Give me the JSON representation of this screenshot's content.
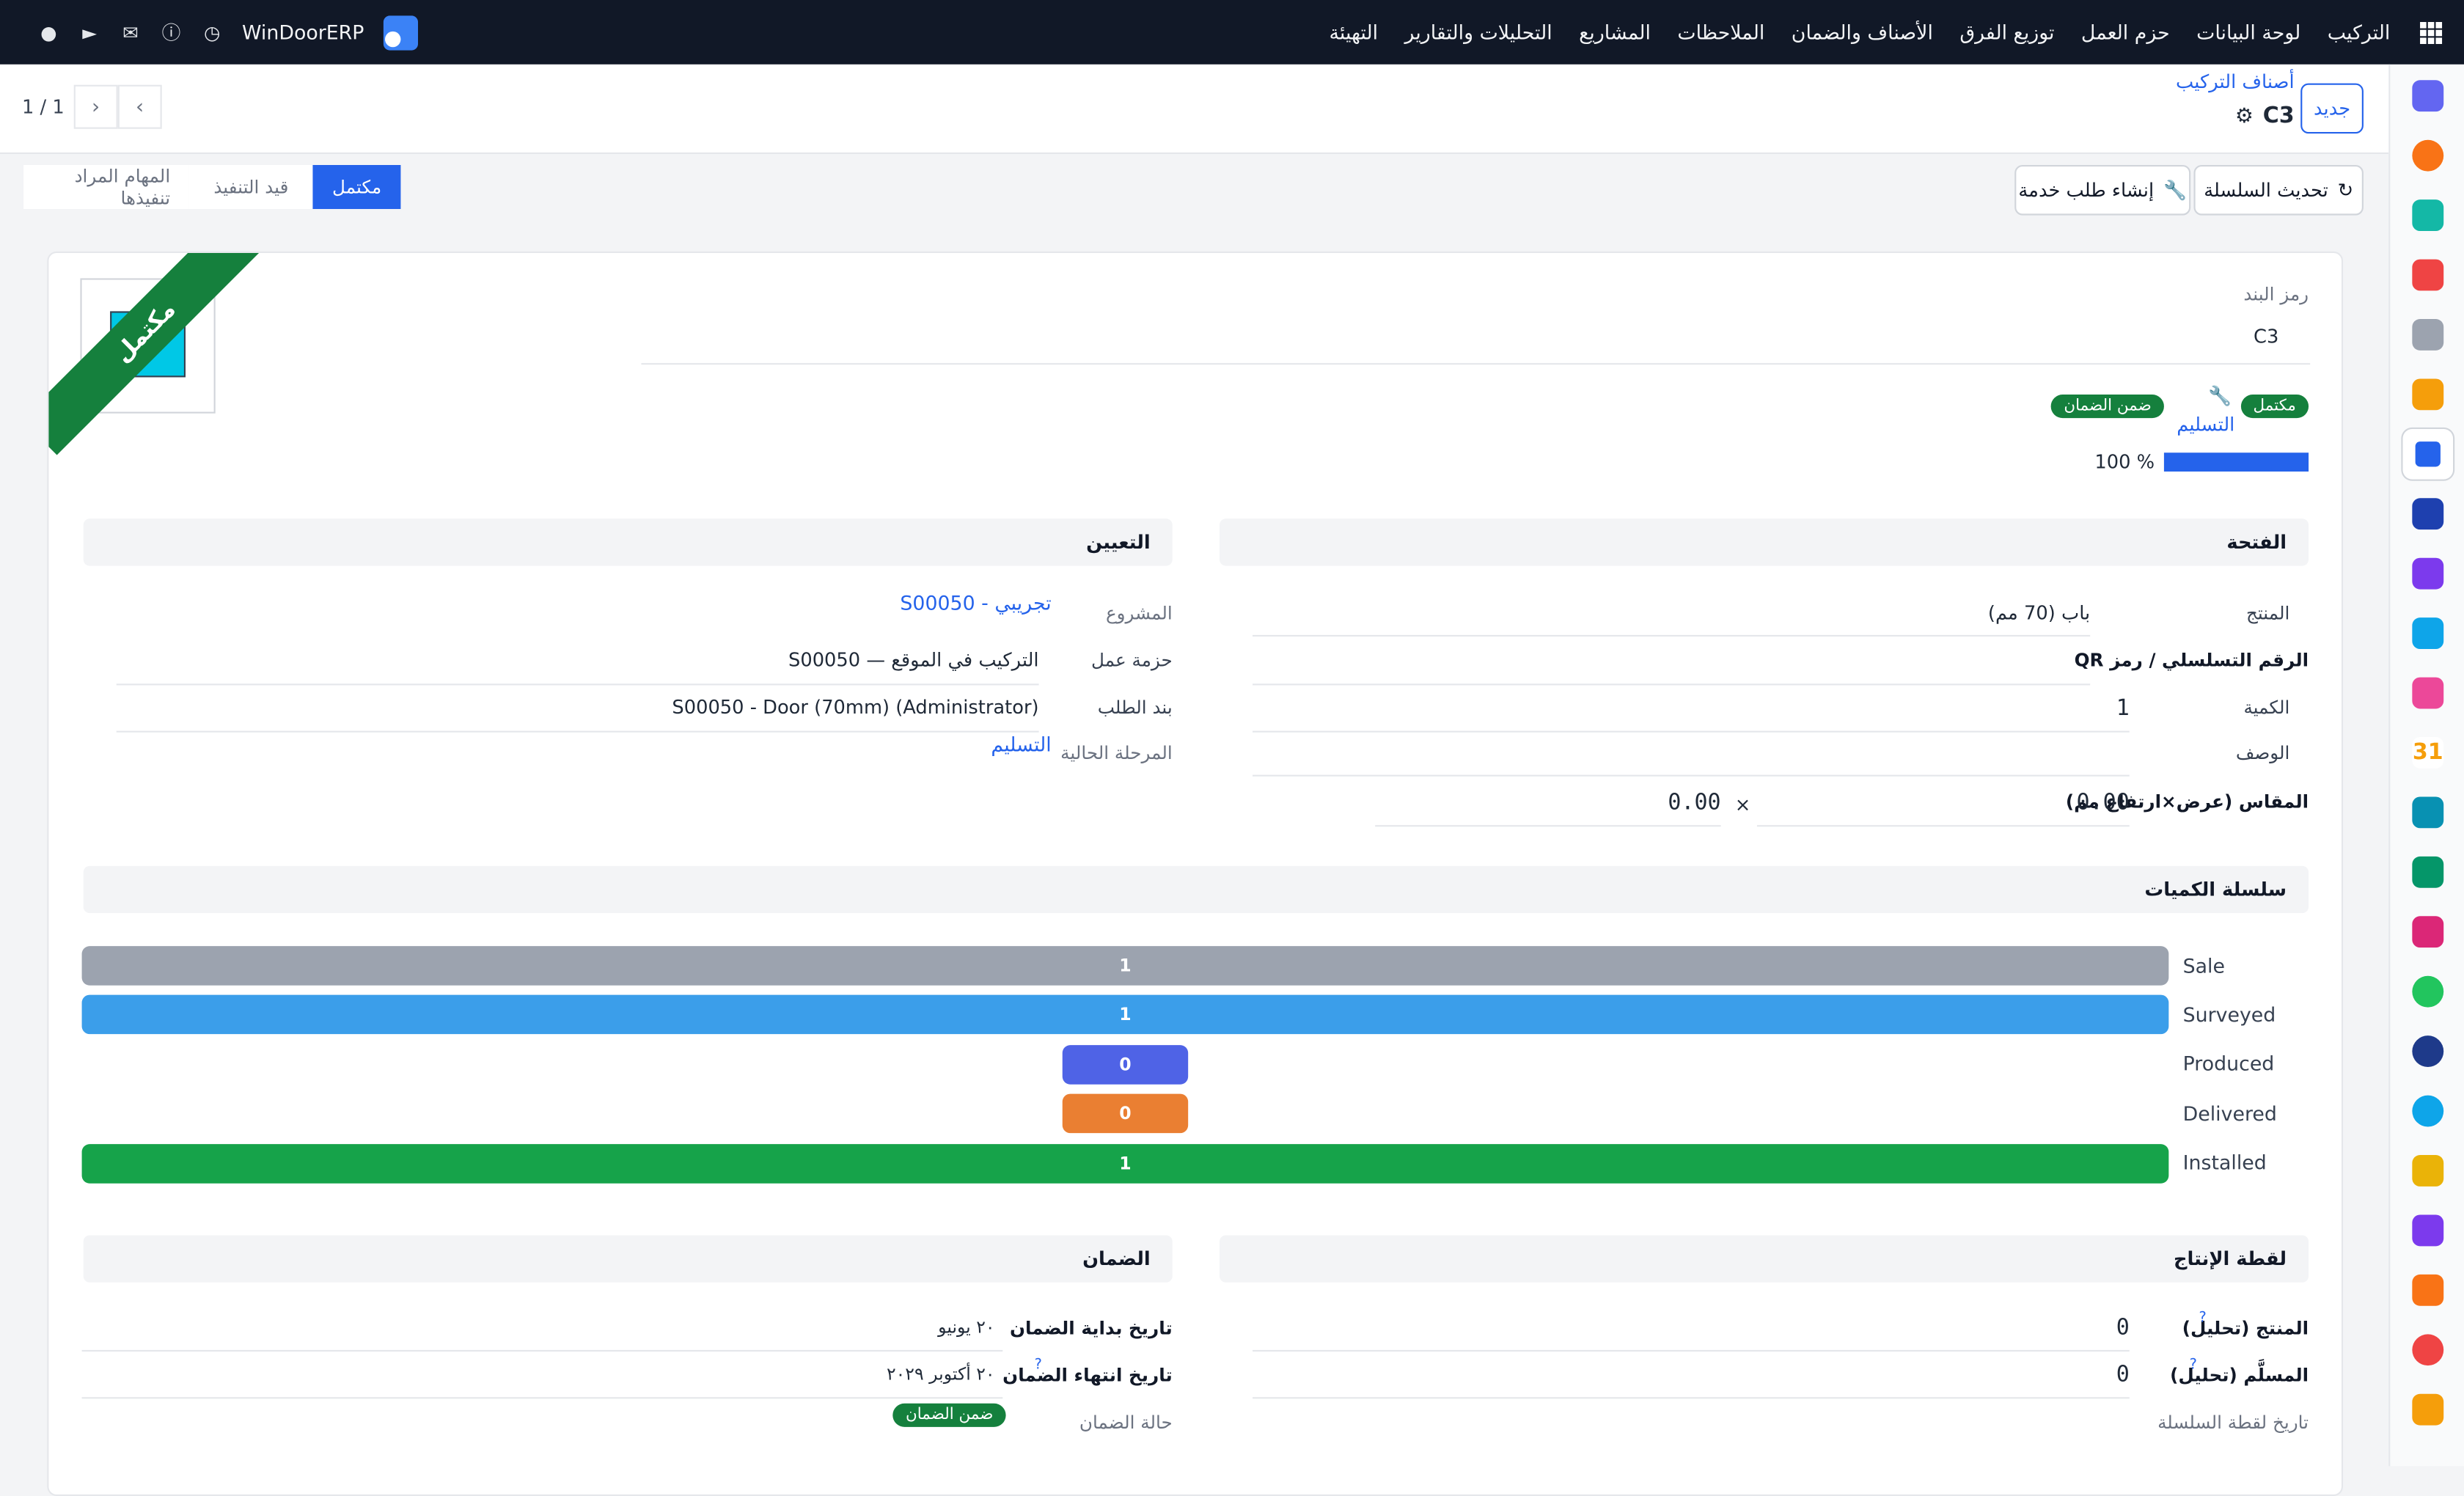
{
  "app": {
    "brand": "WinDoorERP",
    "menu": [
      "التركيب",
      "لوحة البيانات",
      "حزم العمل",
      "توزيع الفرق",
      "الأصناف والضمان",
      "الملاحظات",
      "المشاريع",
      "التحليلات والتقارير",
      "التهيئة"
    ]
  },
  "control": {
    "new_label": "جديد",
    "breadcrumb": "أصناف التركيب",
    "record_title": "C3",
    "pager": "1 / 1"
  },
  "actions": {
    "refresh_chain": "تحديث السلسلة",
    "create_service": "إنشاء طلب خدمة"
  },
  "statusbar": {
    "stages": [
      "مكتمل",
      "قيد التنفيذ",
      "المهام المراد تنفيذها"
    ]
  },
  "header": {
    "ribbon": "مكتمل",
    "item_code_label": "رمز البند",
    "item_code": "C3",
    "badge_done": "مكتمل",
    "stage_link": "التسليم",
    "badge_warranty": "ضمن الضمان",
    "progress_pct": 100,
    "progress_text": "100 %"
  },
  "opening": {
    "title": "الفتحة",
    "product_label": "المنتج",
    "product": "باب (70 مم)",
    "serial_label": "الرقم التسلسلي / رمز QR",
    "serial": "",
    "qty_label": "الكمية",
    "qty": "1",
    "desc_label": "الوصف",
    "desc": "",
    "size_label": "المقاس (عرض×ارتفاع مم)",
    "width": "0.00",
    "times": "×",
    "height": "0.00"
  },
  "assignment": {
    "title": "التعيين",
    "project_label": "المشروع",
    "project": "تجريبي - S00050",
    "workpack_label": "حزمة عمل",
    "workpack": "التركيب في الموقع — S00050",
    "order_line_label": "بند الطلب",
    "order_line": "S00050 - Door (70mm) (Administrator)",
    "current_stage_label": "المرحلة الحالية",
    "current_stage": "التسليم"
  },
  "chain": {
    "title": "سلسلة الكميات",
    "rows": [
      {
        "label": "Sale",
        "value": "1",
        "color": "#9ca3af"
      },
      {
        "label": "Surveyed",
        "value": "1",
        "color": "#3b9eea"
      },
      {
        "label": "Produced",
        "value": "0",
        "color": "#4f63e6"
      },
      {
        "label": "Delivered",
        "value": "0",
        "color": "#ea7f32"
      },
      {
        "label": "Installed",
        "value": "1",
        "color": "#16a34a"
      }
    ]
  },
  "snapshot": {
    "title": "لقطة الإنتاج",
    "produced_label": "المنتج (تحليل)",
    "produced": "0",
    "delivered_label": "المسلَّم (تحليل)",
    "delivered": "0",
    "chain_date_label": "تاريخ لقطة السلسلة"
  },
  "warranty": {
    "title": "الضمان",
    "start_label": "تاريخ بداية الضمان",
    "start": "٢٠ يونيو",
    "end_label": "تاريخ انتهاء الضمان",
    "end": "٢٠ أكتوبر ٢٠٢٩",
    "status_label": "حالة الضمان",
    "status": "ضمن الضمان"
  },
  "colors": {
    "accent": "#2563eb",
    "success": "#15803d",
    "topnav": "#111827"
  }
}
